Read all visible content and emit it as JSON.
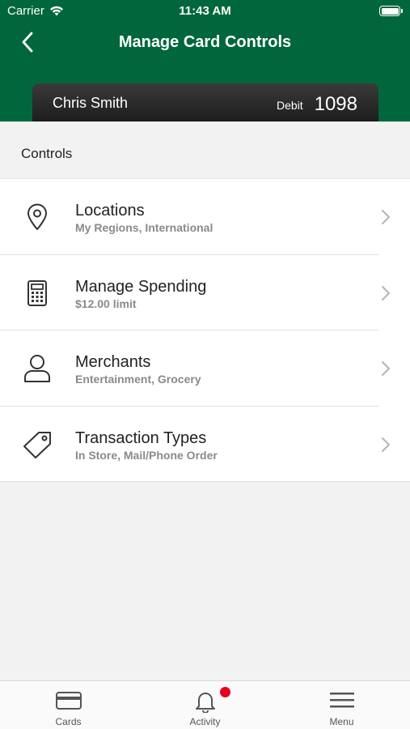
{
  "status_bar": {
    "carrier": "Carrier",
    "time": "11:43 AM"
  },
  "header": {
    "title": "Manage Card Controls",
    "background_color": "#00673c"
  },
  "card": {
    "holder": "Chris Smith",
    "type": "Debit",
    "last_four": "1098"
  },
  "section": {
    "label": "Controls"
  },
  "controls": [
    {
      "title": "Locations",
      "subtitle": "My Regions, International",
      "icon": "location-pin-icon"
    },
    {
      "title": "Manage Spending",
      "subtitle": "$12.00 limit",
      "icon": "calculator-icon"
    },
    {
      "title": "Merchants",
      "subtitle": "Entertainment, Grocery",
      "icon": "person-icon"
    },
    {
      "title": "Transaction Types",
      "subtitle": "In Store, Mail/Phone Order",
      "icon": "tag-icon"
    }
  ],
  "tabbar": {
    "tabs": [
      {
        "label": "Cards",
        "icon": "card-icon"
      },
      {
        "label": "Activity",
        "icon": "bell-icon",
        "has_badge": true
      },
      {
        "label": "Menu",
        "icon": "hamburger-menu-icon"
      }
    ],
    "badge_color": "#e8001c"
  }
}
